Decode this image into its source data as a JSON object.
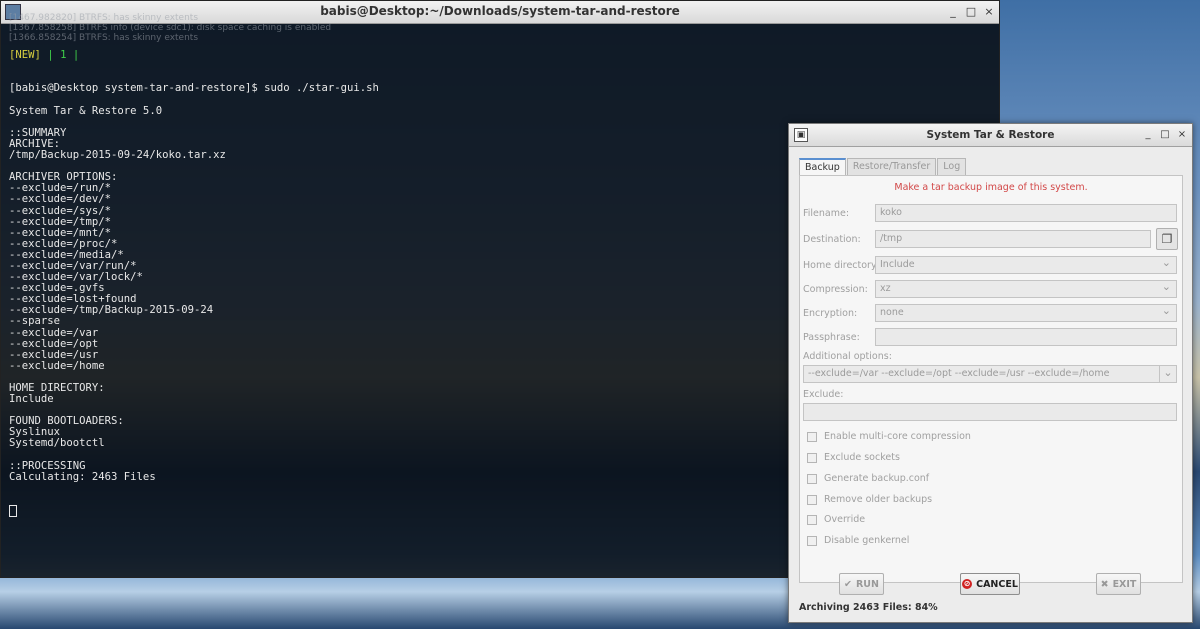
{
  "terminal": {
    "title": "babis@Desktop:~/Downloads/system-tar-and-restore",
    "ghost_lines": [
      "[1467.982820] BTRFS: has skinny extents",
      "[1367.858258] BTRFS info (device sdc1): disk space caching is enabled",
      "[1366.858254] BTRFS: has skinny extents"
    ],
    "status": {
      "open": "[",
      "new": "NEW",
      "close": "]",
      "sep1": " | ",
      "num": "1",
      "sep2": " |"
    },
    "lines": [
      "[babis@Desktop system-tar-and-restore]$ sudo ./star-gui.sh",
      "",
      "System Tar & Restore 5.0",
      "",
      "::SUMMARY",
      "ARCHIVE:",
      "/tmp/Backup-2015-09-24/koko.tar.xz",
      "",
      "ARCHIVER OPTIONS:",
      "--exclude=/run/*",
      "--exclude=/dev/*",
      "--exclude=/sys/*",
      "--exclude=/tmp/*",
      "--exclude=/mnt/*",
      "--exclude=/proc/*",
      "--exclude=/media/*",
      "--exclude=/var/run/*",
      "--exclude=/var/lock/*",
      "--exclude=.gvfs",
      "--exclude=lost+found",
      "--exclude=/tmp/Backup-2015-09-24",
      "--sparse",
      "--exclude=/var",
      "--exclude=/opt",
      "--exclude=/usr",
      "--exclude=/home",
      "",
      "HOME DIRECTORY:",
      "Include",
      "",
      "FOUND BOOTLOADERS:",
      "Syslinux",
      "Systemd/bootctl",
      "",
      "::PROCESSING",
      "Calculating: 2463 Files"
    ],
    "buttons": {
      "minimize": "_",
      "maximize": "□",
      "close": "×"
    }
  },
  "dialog": {
    "title": "System Tar & Restore",
    "buttons": {
      "minimize": "_",
      "maximize": "□",
      "close": "×"
    },
    "tabs": [
      "Backup",
      "Restore/Transfer",
      "Log"
    ],
    "hint": "Make a tar backup image of this system.",
    "filename": {
      "label": "Filename:",
      "value": "koko"
    },
    "destination": {
      "label": "Destination:",
      "value": "/tmp"
    },
    "home_directory": {
      "label": "Home directory:",
      "value": "Include"
    },
    "compression": {
      "label": "Compression:",
      "value": "xz"
    },
    "encryption": {
      "label": "Encryption:",
      "value": "none"
    },
    "passphrase": {
      "label": "Passphrase:",
      "value": ""
    },
    "additional_options": {
      "label": "Additional options:",
      "value": "--exclude=/var --exclude=/opt --exclude=/usr --exclude=/home"
    },
    "exclude": {
      "label": "Exclude:",
      "value": ""
    },
    "checkboxes": [
      "Enable multi-core compression",
      "Exclude sockets",
      "Generate backup.conf",
      "Remove older backups",
      "Override",
      "Disable genkernel"
    ],
    "run_label": "RUN",
    "cancel_label": "CANCEL",
    "exit_label": "EXIT",
    "status": "Archiving 2463 Files: 84%"
  }
}
